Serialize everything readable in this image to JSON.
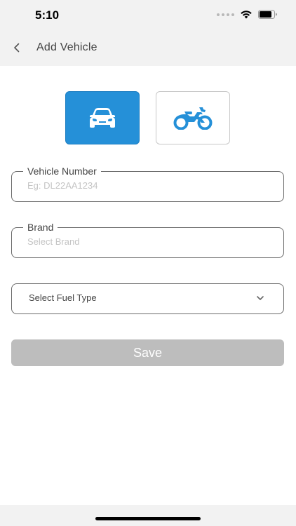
{
  "status_bar": {
    "time": "5:10"
  },
  "header": {
    "back_icon": "chevron-left-icon",
    "title": "Add Vehicle"
  },
  "vehicle_types": [
    {
      "name": "Car",
      "icon": "car-icon",
      "selected": true
    },
    {
      "name": "Bike",
      "icon": "motorcycle-icon",
      "selected": false
    }
  ],
  "form": {
    "vehicle_number": {
      "label": "Vehicle Number",
      "placeholder": "Eg: DL22AA1234",
      "value": ""
    },
    "brand": {
      "label": "Brand",
      "placeholder": "Select Brand",
      "value": ""
    },
    "fuel_type": {
      "label": "Select Fuel Type",
      "icon": "chevron-down-icon"
    }
  },
  "save_label": "Save",
  "colors": {
    "accent": "#2590d8",
    "disabled_button": "#bdbdbd",
    "header_bg": "#f2f2f2"
  }
}
